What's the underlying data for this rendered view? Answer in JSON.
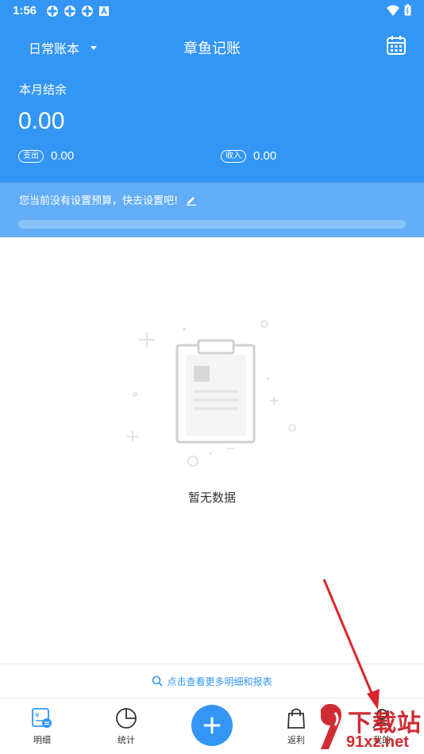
{
  "status_bar": {
    "time": "1:56"
  },
  "app_bar": {
    "book_name": "日常账本",
    "title": "章鱼记账"
  },
  "summary": {
    "balance_label": "本月结余",
    "balance_value": "0.00",
    "expense_badge": "支出",
    "expense_value": "0.00",
    "income_badge": "收入",
    "income_value": "0.00"
  },
  "budget": {
    "text": "您当前没有设置预算，快去设置吧!",
    "progress": 0
  },
  "empty_state": {
    "text": "暂无数据"
  },
  "more_link": {
    "text": "点击查看更多明细和报表"
  },
  "bottom_nav": {
    "items": [
      {
        "label": "明细",
        "icon": "detail-icon"
      },
      {
        "label": "统计",
        "icon": "pie-chart-icon"
      },
      {
        "label": "",
        "icon": "plus-icon"
      },
      {
        "label": "返利",
        "icon": "shopping-bag-icon"
      },
      {
        "label": "我的",
        "icon": "user-icon"
      }
    ]
  },
  "watermark": {
    "text": "下载站",
    "url_text": "91xz.net"
  },
  "colors": {
    "primary": "#3396f4",
    "budget_bar": "#62adf5",
    "arrow": "#d9262c"
  }
}
